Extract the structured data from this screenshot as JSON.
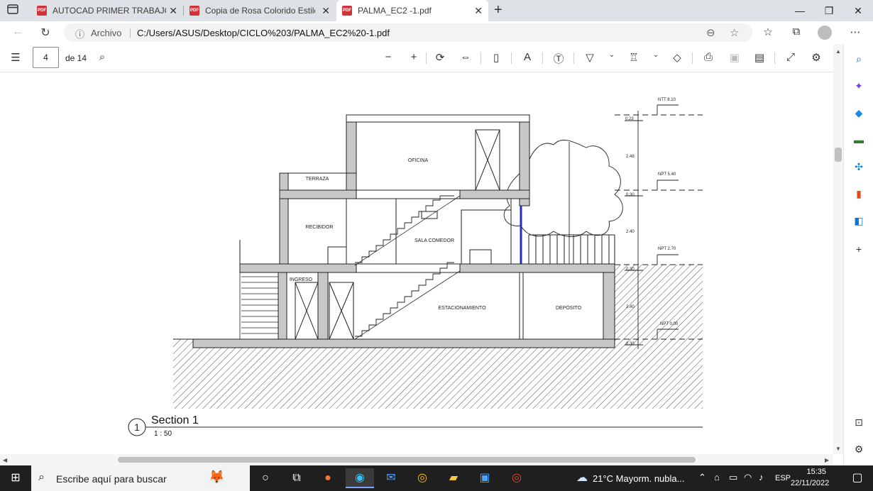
{
  "tabs": [
    {
      "title": "AUTOCAD PRIMER TRABAJO.pdf",
      "active": false
    },
    {
      "title": "Copia de Rosa Colorido Estilo Se",
      "active": false
    },
    {
      "title": "PALMA_EC2 -1.pdf",
      "active": true
    }
  ],
  "address": {
    "scheme_label": "Archivo",
    "url": "C:/Users/ASUS/Desktop/CICLO%203/PALMA_EC2%20-1.pdf"
  },
  "pdf_toolbar": {
    "page_current": "4",
    "page_total": "de 14"
  },
  "drawing": {
    "levels": [
      {
        "label": "NTT 8.10"
      },
      {
        "label": "NPT 5.40"
      },
      {
        "label": "NPT 2.70"
      },
      {
        "label": "NPT 0.00"
      }
    ],
    "dims": [
      "0.23",
      "2.48",
      "0.30",
      "2.40",
      "0.30",
      "2.40",
      "0.30"
    ],
    "rooms": {
      "oficina": "OFICINA",
      "terraza": "TERRAZA",
      "recibidor": "RECIBIDOR",
      "sala": "SALA COMEDOR",
      "ingreso": "INGRESO",
      "estacionamiento": "ESTACIONAMIENTO",
      "deposito": "DEPÓSITO"
    },
    "section_number": "1",
    "section_title": "Section 1",
    "section_scale": "1 : 50"
  },
  "taskbar": {
    "search_placeholder": "Escribe aquí para buscar",
    "weather": "21°C  Mayorm. nubla...",
    "language": "ESP",
    "time": "15:35",
    "date": "22/11/2022"
  },
  "colors": {
    "tabstrip": "#dee1e6",
    "pdf_red": "#d13438",
    "taskbar": "#1f1f1f",
    "wall_gray": "#c8c8c8"
  }
}
